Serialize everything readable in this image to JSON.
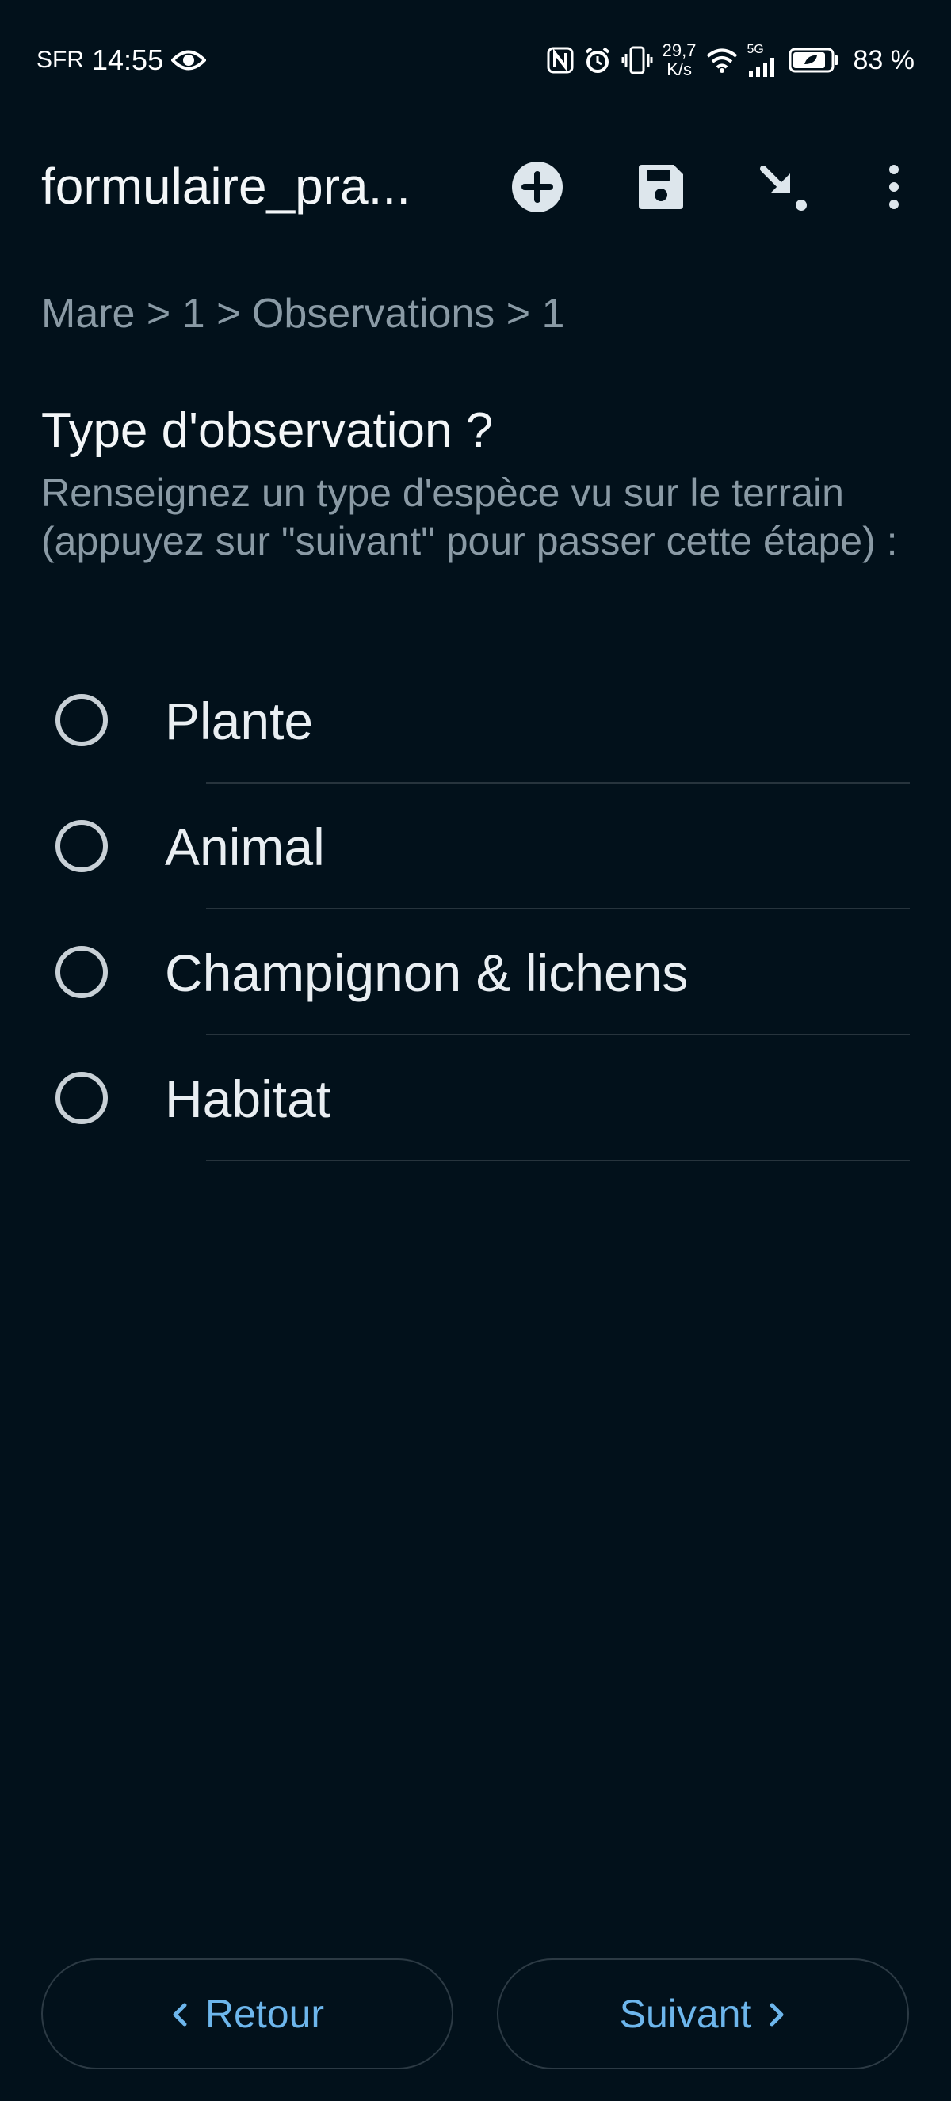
{
  "status_bar": {
    "carrier": "SFR",
    "time": "14:55",
    "net_speed_value": "29,7",
    "net_speed_unit": "K/s",
    "signal_label": "5G",
    "battery": "83 %",
    "icons": [
      "eye-icon",
      "nfc-icon",
      "alarm-icon",
      "vibrate-icon",
      "wifi-icon",
      "signal-icon",
      "battery-icon"
    ]
  },
  "toolbar": {
    "title": "formulaire_pra...",
    "icons": [
      "add-circle-icon",
      "save-icon",
      "arrow-down-right-icon",
      "more-vert-icon"
    ]
  },
  "breadcrumb": "Mare > 1 > Observations > 1",
  "question": {
    "title": "Type d'observation ?",
    "hint": "Renseignez un type d'espèce vu sur le terrain (appuyez sur \"suivant\" pour passer cette étape) :"
  },
  "options": [
    {
      "label": "Plante",
      "selected": false
    },
    {
      "label": "Animal",
      "selected": false
    },
    {
      "label": "Champignon & lichens",
      "selected": false
    },
    {
      "label": "Habitat",
      "selected": false
    }
  ],
  "navigation": {
    "back_label": "Retour",
    "next_label": "Suivant"
  },
  "colors": {
    "background": "#02111b",
    "accent": "#6db6ec",
    "secondary_text": "#8a9aa5"
  }
}
